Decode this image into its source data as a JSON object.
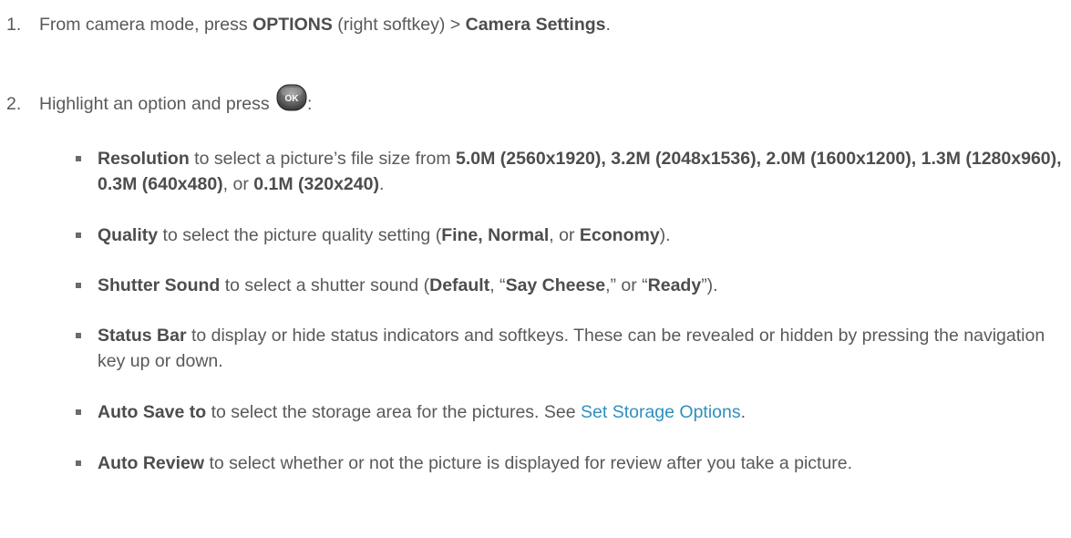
{
  "step1": {
    "num": "1.",
    "t1": "From camera mode, press ",
    "b1": "OPTIONS",
    "t2": " (right softkey) > ",
    "b2": "Camera Settings",
    "t3": "."
  },
  "step2": {
    "num": "2.",
    "t1": "Highlight an option and press ",
    "icon_label": "OK",
    "t2": ":"
  },
  "bullets": {
    "resolution": {
      "b1": "Resolution",
      "t1": " to select a picture’s file size from ",
      "b2": "5.0M (2560x1920), 3.2M (2048x1536), 2.0M (1600x1200), 1.3M (1280x960), 0.3M (640x480)",
      "t2": ", or ",
      "b3": "0.1M (320x240)",
      "t3": "."
    },
    "quality": {
      "b1": "Quality",
      "t1": " to select the picture quality setting (",
      "b2": "Fine, Normal",
      "t2": ", or ",
      "b3": "Economy",
      "t3": ")."
    },
    "shutter": {
      "b1": "Shutter Sound",
      "t1": " to select a shutter sound (",
      "b2": "Default",
      "t2": ", “",
      "b3": "Say Cheese",
      "t3": ",” or “",
      "b4": "Ready",
      "t4": "”)."
    },
    "status": {
      "b1": "Status Bar",
      "t1": " to display or hide status indicators and softkeys. These can be revealed or hidden by pressing the navigation key up or down."
    },
    "autosave": {
      "b1": "Auto Save to",
      "t1": " to select the storage area for the pictures. See ",
      "link": "Set Storage Options",
      "t2": "."
    },
    "autoreview": {
      "b1": "Auto Review",
      "t1": " to select whether or not the picture is displayed for review after you take a picture."
    }
  },
  "colors": {
    "text": "#595959",
    "link": "#2f8fbf",
    "bullet": "#6b6b6b"
  },
  "icons": {
    "ok": "ok-key-icon"
  }
}
